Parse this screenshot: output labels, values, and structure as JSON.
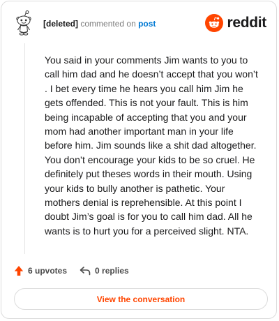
{
  "header": {
    "username": "[deleted]",
    "action_text": "commented on",
    "target_text": "post",
    "brand": "reddit"
  },
  "comment": {
    "body": "You said in your comments Jim wants to you to call him dad and he doesn’t accept that you won’t . I bet every time he hears you call him Jim he gets offended. This is not your fault. This is him being incapable of accepting that you and your mom had another important man in your life before him. Jim sounds like a shit dad altogether. You don’t encourage your kids to be so cruel. He definitely put theses words in their mouth. Using your kids to bully another is pathetic. Your mothers denial is reprehensible. At this point I doubt Jim’s goal is for you to call him dad. All he wants is to hurt you for a perceived slight. NTA."
  },
  "actions": {
    "upvotes": "6 upvotes",
    "replies": "0 replies"
  },
  "cta": {
    "label": "View the conversation"
  },
  "colors": {
    "brand": "#ff4500",
    "link": "#0079d3"
  },
  "icons": {
    "avatar": "snoo-avatar-icon",
    "logo": "reddit-logo-icon",
    "upvote": "upvote-arrow-icon",
    "reply": "reply-arrow-icon"
  }
}
